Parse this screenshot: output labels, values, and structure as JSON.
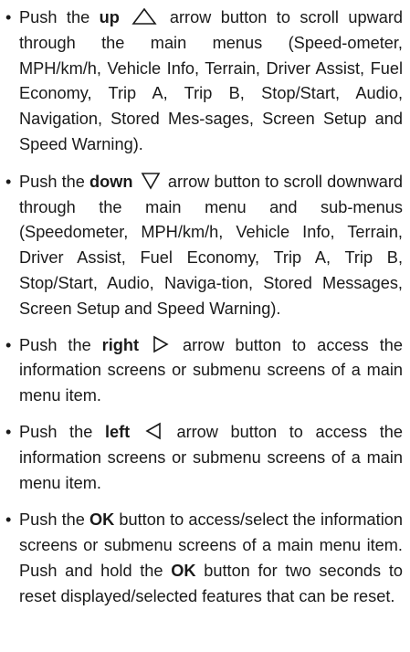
{
  "bullet_glyph": "•",
  "items": [
    {
      "pre": "Push the",
      "key": "up",
      "icon": "up-triangle-icon",
      "post": "arrow button to scroll upward through the main menus (Speed-ometer, MPH/km/h, Vehicle Info, Terrain, Driver Assist, Fuel Economy, Trip A, Trip B, Stop/Start, Audio, Navigation, Stored Mes-sages, Screen Setup and Speed Warning)."
    },
    {
      "pre": "Push the",
      "key": "down",
      "icon": "down-triangle-icon",
      "post": "arrow button to scroll downward through the main menu and sub-menus (Speedometer, MPH/km/h, Vehicle Info, Terrain, Driver Assist, Fuel Economy, Trip A, Trip B, Stop/Start, Audio, Naviga-tion, Stored Messages, Screen Setup and Speed Warning)."
    },
    {
      "pre": "Push the",
      "key": "right",
      "icon": "right-triangle-icon",
      "post": "arrow button to access the information screens or submenu screens of a main menu item."
    },
    {
      "pre": "Push the",
      "key": "left",
      "icon": "left-triangle-icon",
      "post": "arrow button to access the information screens or submenu screens of a main menu item."
    },
    {
      "pre": "Push the",
      "key": "OK",
      "mid": "button to access/select the information screens or submenu screens of a main menu item. Push and hold the",
      "key2": "OK",
      "post": "button for two seconds to reset displayed/selected features that can be reset."
    }
  ]
}
